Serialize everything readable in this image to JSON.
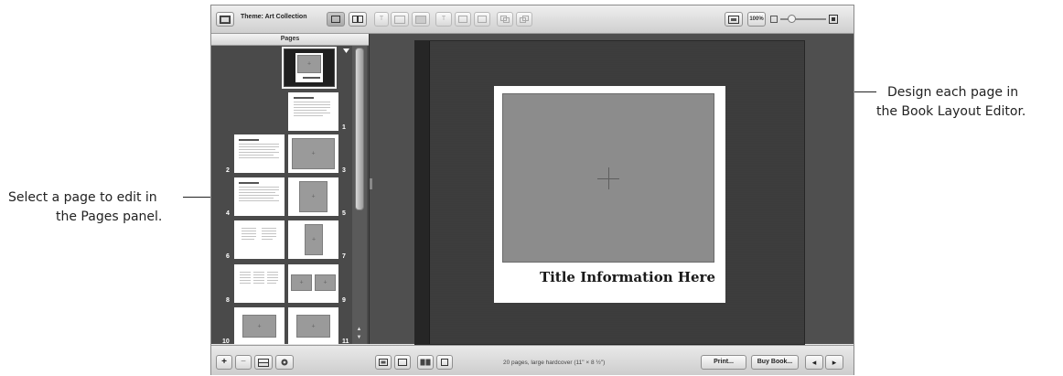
{
  "callouts": {
    "right_line1": "Design each page in",
    "right_line2": "the Book Layout Editor.",
    "left_line1": "Select a page to edit in",
    "left_line2": "the Pages panel."
  },
  "toolbar": {
    "theme_label": "Theme: Art Collection",
    "zoom_label": "100%",
    "zoom_level_percent": 100
  },
  "pages_panel": {
    "header": "Pages",
    "page_numbers": [
      "1",
      "2",
      "3",
      "4",
      "5",
      "6",
      "7",
      "8",
      "9",
      "10",
      "11"
    ]
  },
  "editor": {
    "book_title": "Title Information Here"
  },
  "bottom_bar": {
    "add_label": "+",
    "remove_label": "−",
    "status_text": "20 pages, large hardcover (11\" × 8 ½\")",
    "print_label": "Print...",
    "buy_label": "Buy Book...",
    "prev_label": "◂",
    "next_label": "▸"
  }
}
